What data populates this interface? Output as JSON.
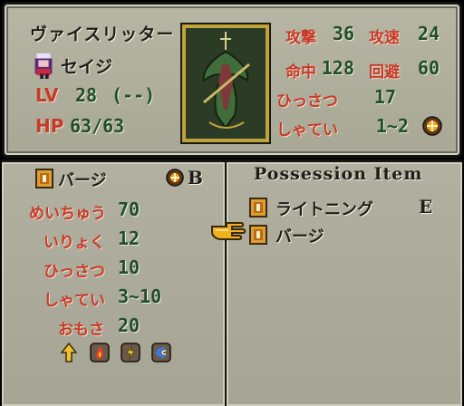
{
  "unit": {
    "class_name": "ヴァイスリッター",
    "name": "セイジ",
    "lv_label": "LV",
    "lv": "28",
    "exp": "(--)",
    "hp_label": "HP",
    "hp": "63/63"
  },
  "stats": [
    {
      "label": "攻撃",
      "value": "36"
    },
    {
      "label": "攻速",
      "value": "24"
    },
    {
      "label": "命中",
      "value": "128"
    },
    {
      "label": "回避",
      "value": "60"
    },
    {
      "label": "ひっさつ",
      "value": "17"
    },
    {
      "label": "しゃてい",
      "value": "1~2"
    }
  ],
  "weapon": {
    "name": "バージ",
    "rank": "B",
    "labels": {
      "hit": "めいちゅう",
      "might": "いりょく",
      "crit": "ひっさつ",
      "range": "しゃてい",
      "weight": "おもさ"
    },
    "values": {
      "hit": "70",
      "might": "12",
      "crit": "10",
      "range": "3~10",
      "weight": "20"
    }
  },
  "inventory": {
    "title": "Possession Item",
    "items": [
      {
        "name": "ライトニング",
        "equip": "E"
      },
      {
        "name": "バージ",
        "equip": ""
      }
    ]
  },
  "colors": {
    "panel": "#aeac9c",
    "label_red": "#c43c28",
    "value_green": "#224c2a",
    "frame_gold": "#c0a33a"
  }
}
